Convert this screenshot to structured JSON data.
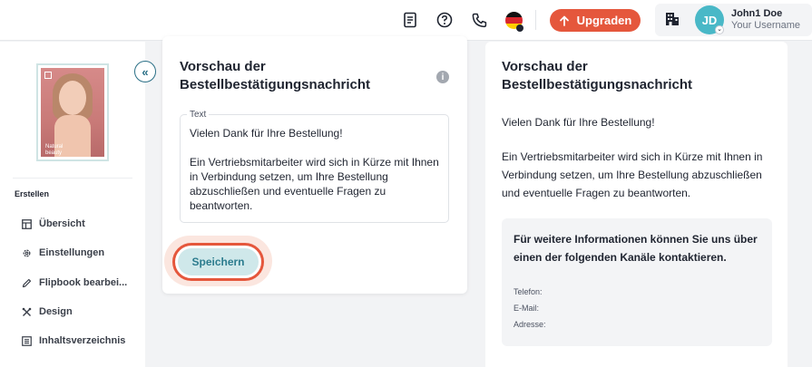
{
  "header": {
    "upgrade_label": "Upgraden",
    "user_name": "John1 Doe",
    "user_subtitle": "Your Username",
    "avatar_initials": "JD",
    "icons": [
      "document-icon",
      "help-icon",
      "phone-icon",
      "flag-germany-icon",
      "building-icon"
    ],
    "accent_color": "#e5573c"
  },
  "sidebar": {
    "cover_caption_line1": "Natural",
    "cover_caption_line2": "beauty",
    "collapse_symbol": "«",
    "section_label": "Erstellen",
    "items": [
      {
        "label": "Übersicht",
        "icon": "layout-icon"
      },
      {
        "label": "Einstellungen",
        "icon": "gear-icon"
      },
      {
        "label": "Flipbook bearbei...",
        "icon": "pencil-icon"
      },
      {
        "label": "Design",
        "icon": "tools-icon"
      },
      {
        "label": "Inhaltsverzeichnis",
        "icon": "list-icon"
      }
    ]
  },
  "editor": {
    "title_line1": "Vorschau der",
    "title_line2": "Bestellbestätigungsnachricht",
    "info_symbol": "i",
    "textarea_label": "Text",
    "text_lines": [
      "Vielen Dank für Ihre Bestellung!",
      "Ein Vertriebsmitarbeiter wird sich in Kürze mit Ihnen",
      "in Verbindung setzen, um Ihre Bestellung",
      "abzuschließen und eventuelle Fragen zu",
      "beantworten."
    ],
    "save_label": "Speichern"
  },
  "preview": {
    "title_line1": "Vorschau der",
    "title_line2": "Bestellbestätigungsnachricht",
    "text_lines": [
      "Vielen Dank für Ihre Bestellung!",
      "Ein Vertriebsmitarbeiter wird sich in Kürze mit Ihnen in",
      "Verbindung setzen, um Ihre Bestellung abzuschließen",
      "und eventuelle Fragen zu beantworten."
    ],
    "contact_title_line1": "Für weitere Informationen können Sie uns über",
    "contact_title_line2": "einen der folgenden Kanäle kontaktieren.",
    "fields": [
      "Telefon:",
      "E-Mail:",
      "Adresse:"
    ]
  }
}
